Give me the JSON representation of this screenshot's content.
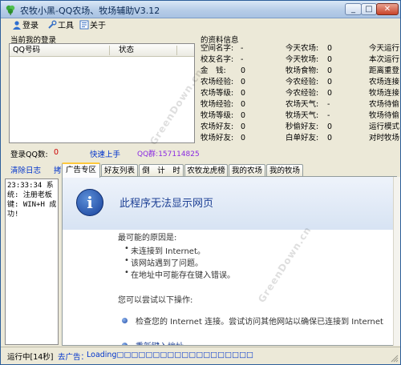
{
  "window": {
    "title": "农牧小黑-QQ农场、牧场辅助V3.12",
    "minimize_glyph": "_",
    "maximize_glyph": "□",
    "close_glyph": "✕"
  },
  "menu": {
    "login": "登录",
    "tools": "工具",
    "about": "关于"
  },
  "left_panel": {
    "heading": "当前我的登录",
    "columns": [
      "QQ号码",
      "状态"
    ]
  },
  "info": {
    "heading": "的资料信息",
    "rows": [
      [
        "空间名字:",
        "-",
        "今天农场:",
        "0",
        "今天运行"
      ],
      [
        "校友名字:",
        "-",
        "今天牧场:",
        "0",
        "本次运行"
      ],
      [
        "金　钱:",
        "0",
        "牧场食物:",
        "0",
        "距离重登"
      ],
      [
        "农场经验:",
        "0",
        "今农经验:",
        "0",
        "农场连接"
      ],
      [
        "农场等级:",
        "0",
        "今农经验:",
        "0",
        "牧场连接"
      ],
      [
        "牧场经验:",
        "0",
        "农场天气:",
        "-",
        "农场待偷"
      ],
      [
        "牧场等级:",
        "0",
        "牧场天气:",
        "-",
        "牧场待偷"
      ],
      [
        "农场好友:",
        "0",
        "秒偷好友:",
        "0",
        "运行模式"
      ],
      [
        "牧场好友:",
        "0",
        "白单好友:",
        "0",
        "对时牧场"
      ]
    ]
  },
  "status_row": {
    "login_count_label": "登录QQ数:",
    "login_count_value": "0",
    "quick_start": "快速上手",
    "qq_group": "QQ群:157114825"
  },
  "left_actions": {
    "clear_log": "清除日志",
    "second": "拷"
  },
  "log": {
    "lines": [
      "23:33:34 系",
      "统: 注册老板",
      "键: WIN+H 成",
      "功!"
    ]
  },
  "tabs": [
    "广告专区",
    "好友列表",
    "倒　计　时",
    "农牧龙虎榜",
    "我的农场",
    "我的牧场"
  ],
  "browser": {
    "title": "此程序无法显示网页",
    "possible_causes_heading": "最可能的原因是:",
    "causes": [
      "未连接到 Internet。",
      "该网站遇到了问题。",
      "在地址中可能存在键入错误。"
    ],
    "try_heading": "您可以尝试以下操作:",
    "actions": [
      "检查您的 Internet 连接。尝试访问其他网站以确保已连接到 Internet",
      "重新键入地址。"
    ]
  },
  "watermark": "GreenDown.cn",
  "statusbar": {
    "running": "运行中[14秒]",
    "ad_label": "去广告：",
    "loading": "Loading□□□□□□□□□□□□□□□□□□□"
  },
  "colors": {
    "link_blue": "#0033cc",
    "accent_red": "#cc0000",
    "qq_group_purple": "#8a2be2",
    "title_blue": "#1c3f94"
  }
}
